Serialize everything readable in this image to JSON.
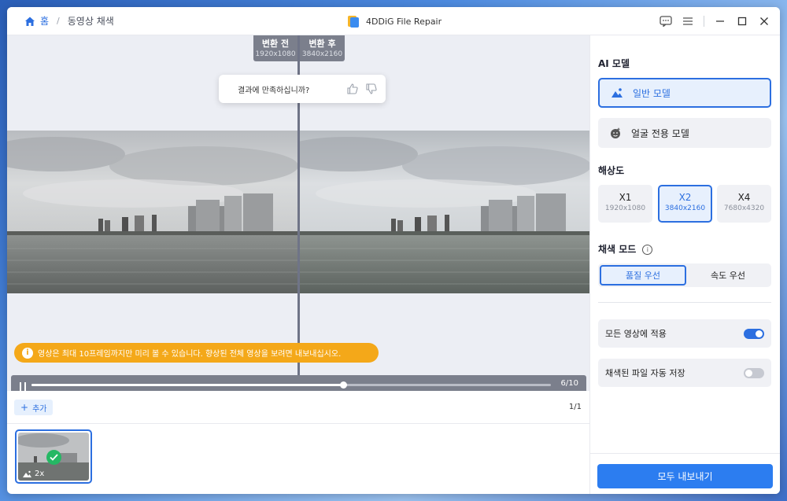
{
  "breadcrumb": {
    "home": "홈",
    "separator": "/",
    "current": "동영상 채색"
  },
  "app": {
    "title": "4DDiG File Repair"
  },
  "window_controls": [
    "feedback-icon",
    "menu-icon",
    "minimize-icon",
    "maximize-icon",
    "close-icon"
  ],
  "compare": {
    "before": {
      "label": "변환 전",
      "resolution": "1920x1080"
    },
    "after": {
      "label": "변환 후",
      "resolution": "3840x2160"
    }
  },
  "feedback": {
    "question": "결과에 만족하십니까?"
  },
  "notice": {
    "text": "영상은 최대 10프레임까지만 미리 볼 수 있습니다. 향상된 전체 영상을 보려면 내보내십시오."
  },
  "player": {
    "frame_counter": "6/10",
    "progress": 0.6
  },
  "list": {
    "add_label": "추가",
    "page_count": "1/1",
    "thumb_scale": "2x"
  },
  "panel": {
    "ai_model_title": "AI 모델",
    "models": [
      {
        "label": "일반 모델",
        "selected": true,
        "icon": "landscape-icon"
      },
      {
        "label": "얼굴 전용 모델",
        "selected": false,
        "icon": "face-icon"
      }
    ],
    "resolution_title": "해상도",
    "resolutions": [
      {
        "label": "X1",
        "size": "1920x1080",
        "selected": false
      },
      {
        "label": "X2",
        "size": "3840x2160",
        "selected": true
      },
      {
        "label": "X4",
        "size": "7680x4320",
        "selected": false
      }
    ],
    "color_mode_title": "채색 모드",
    "color_modes": [
      {
        "label": "품질 우선",
        "selected": true
      },
      {
        "label": "속도 우선",
        "selected": false
      }
    ],
    "toggles": [
      {
        "label": "모든 영상에 적용",
        "on": true
      },
      {
        "label": "채색된 파일 자동 저장",
        "on": false
      }
    ],
    "export_label": "모두 내보내기"
  },
  "colors": {
    "accent": "#2c6fe0",
    "notice": "#f4a819",
    "success": "#25b864"
  }
}
